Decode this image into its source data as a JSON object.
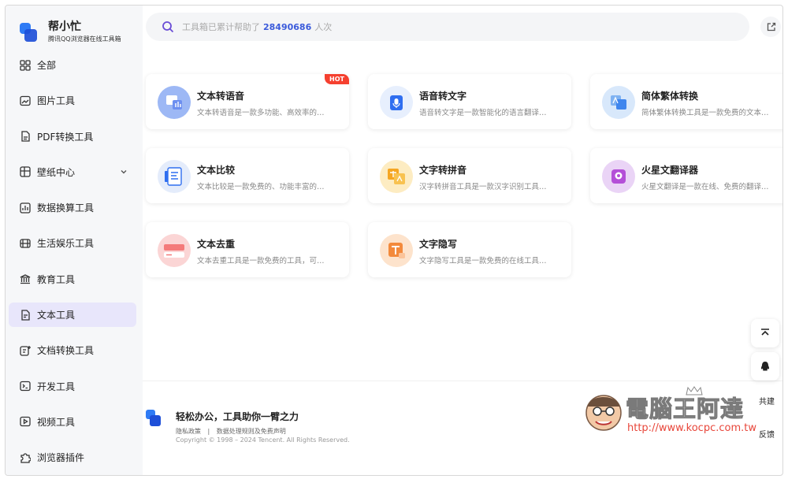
{
  "brand": {
    "title": "帮小忙",
    "subtitle": "腾讯QQ浏览器在线工具箱"
  },
  "nav": [
    {
      "label": "全部",
      "icon": "grid-icon"
    },
    {
      "label": "图片工具",
      "icon": "image-icon"
    },
    {
      "label": "PDF转换工具",
      "icon": "pdf-icon"
    },
    {
      "label": "壁纸中心",
      "icon": "wallpaper-icon",
      "expandable": true
    },
    {
      "label": "数据换算工具",
      "icon": "data-icon"
    },
    {
      "label": "生活娱乐工具",
      "icon": "life-icon"
    },
    {
      "label": "教育工具",
      "icon": "education-icon"
    },
    {
      "label": "文本工具",
      "icon": "text-icon",
      "active": true
    },
    {
      "label": "文档转换工具",
      "icon": "document-icon"
    },
    {
      "label": "开发工具",
      "icon": "code-icon"
    },
    {
      "label": "视频工具",
      "icon": "video-icon"
    },
    {
      "label": "浏览器插件",
      "icon": "plugin-icon"
    }
  ],
  "search": {
    "prefix": "工具箱已累计帮助了",
    "count": "28490686",
    "suffix": "人次"
  },
  "cards": [
    {
      "title": "文本转语音",
      "desc": "文本转语音是一款多功能、高效率的…",
      "badge": "HOT",
      "color": "#9db8f5"
    },
    {
      "title": "语音转文字",
      "desc": "语音转文字是一款智能化的语言翻译…",
      "color": "#e7effd"
    },
    {
      "title": "简体繁体转换",
      "desc": "简体繁体转换工具是一款免费的文本…",
      "color": "#d8e8fb"
    },
    {
      "title": "文本比较",
      "desc": "文本比较是一款免费的、功能丰富的…",
      "color": "#e4ecfb"
    },
    {
      "title": "文字转拼音",
      "desc": "汉字转拼音工具是一款汉字识别工具…",
      "color": "#fdecc2"
    },
    {
      "title": "火星文翻译器",
      "desc": "火星文翻译是一款在线、免费的翻译…",
      "color": "#ead4f6"
    },
    {
      "title": "文本去重",
      "desc": "文本去重工具是一款免费的工具，可…",
      "color": "#fbd5d5"
    },
    {
      "title": "文字隐写",
      "desc": "文字隐写工具是一款免费的在线工具…",
      "color": "#fde3cc"
    }
  ],
  "footer": {
    "slogan": "轻松办公，工具助你一臂之力",
    "links": [
      "隐私政策",
      "|",
      "数据处理规则及免费声明"
    ],
    "copyright": "Copyright © 1998 – 2024 Tencent. All Rights Reserved."
  },
  "float": {
    "cobuild": "共建",
    "feedback": "反馈"
  },
  "watermark": {
    "title": "電腦王阿達",
    "url": "http://www.kocpc.com.tw"
  }
}
